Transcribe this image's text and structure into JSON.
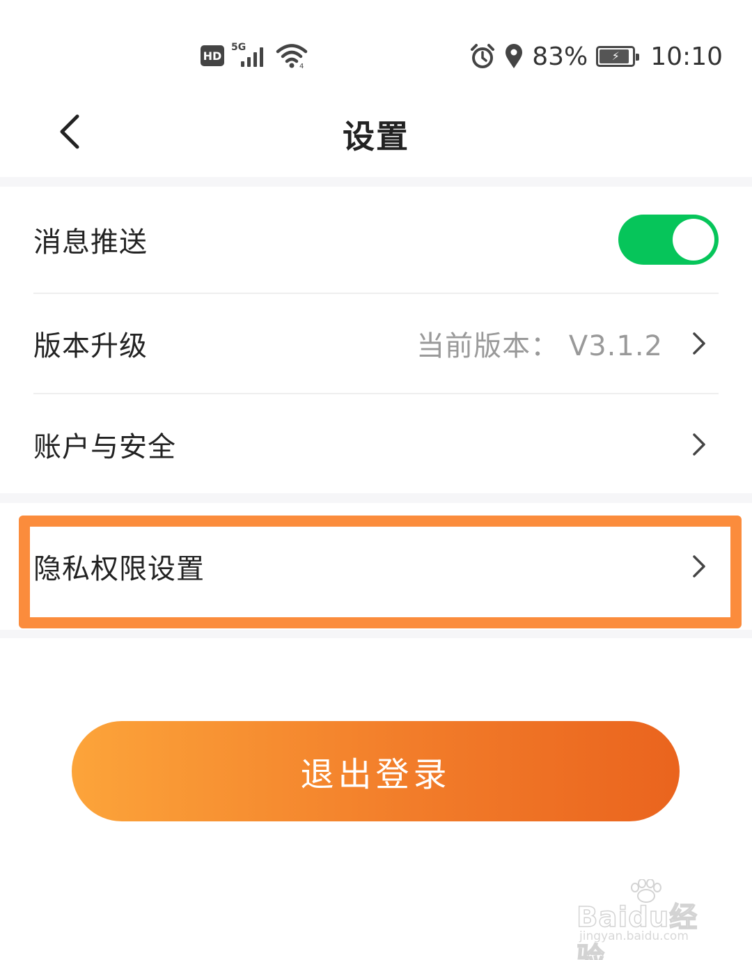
{
  "status_bar": {
    "hd_label": "HD",
    "network_label": "5G",
    "battery_percent": "83%",
    "time": "10:10",
    "icons": [
      "hd-icon",
      "signal-5g-icon",
      "wifi-icon",
      "alarm-icon",
      "location-icon",
      "battery-charging-icon"
    ]
  },
  "nav": {
    "back_icon": "chevron-left-icon",
    "title": "设置"
  },
  "settings": {
    "push": {
      "label": "消息推送",
      "enabled": true,
      "accent": "#06c55a"
    },
    "version": {
      "label": "版本升级",
      "value": "当前版本：  V3.1.2"
    },
    "account": {
      "label": "账户与安全"
    },
    "privacy": {
      "label": "隐私权限设置",
      "highlighted": true,
      "highlight_color": "#fb8c3c"
    }
  },
  "logout": {
    "label": "退出登录",
    "gradient": [
      "#fca43a",
      "#ea641e"
    ]
  },
  "watermark": {
    "brand": "Baidu经验",
    "url": "jingyan.baidu.com"
  }
}
